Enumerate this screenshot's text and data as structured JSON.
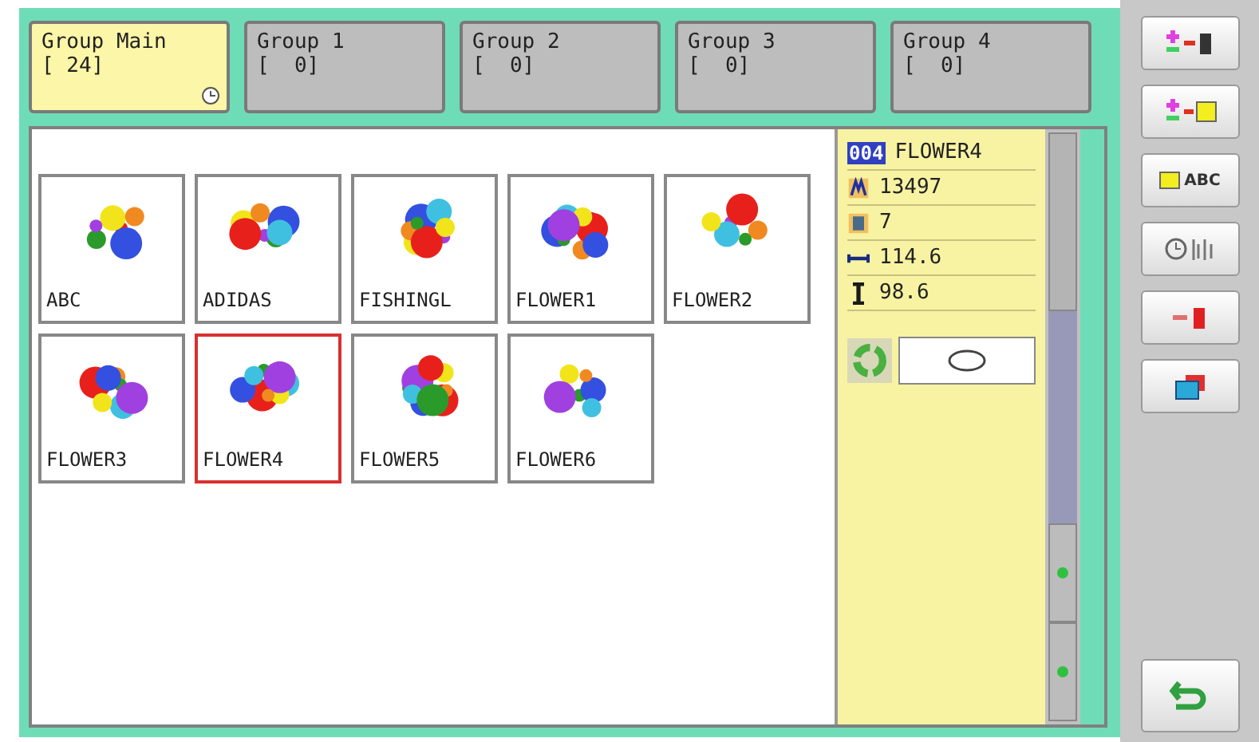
{
  "tabs": [
    {
      "label": "Group Main",
      "count": "[ 24]",
      "selected": true,
      "clock": true
    },
    {
      "label": "Group 1",
      "count": "[  0]",
      "selected": false,
      "clock": false
    },
    {
      "label": "Group 2",
      "count": "[  0]",
      "selected": false,
      "clock": false
    },
    {
      "label": "Group 3",
      "count": "[  0]",
      "selected": false,
      "clock": false
    },
    {
      "label": "Group 4",
      "count": "[  0]",
      "selected": false,
      "clock": false
    }
  ],
  "designs": [
    {
      "name": "ABC",
      "selected": false
    },
    {
      "name": "ADIDAS",
      "selected": false
    },
    {
      "name": "FISHINGL",
      "selected": false
    },
    {
      "name": "FLOWER1",
      "selected": false
    },
    {
      "name": "FLOWER2",
      "selected": false
    },
    {
      "name": "FLOWER3",
      "selected": false
    },
    {
      "name": "FLOWER4",
      "selected": true
    },
    {
      "name": "FLOWER5",
      "selected": false
    },
    {
      "name": "FLOWER6",
      "selected": false
    }
  ],
  "info": {
    "number": "004",
    "name": "FLOWER4",
    "rows": [
      {
        "kind": "stitches",
        "value": "13497"
      },
      {
        "kind": "colors",
        "value": "7"
      },
      {
        "kind": "width",
        "value": "114.6"
      },
      {
        "kind": "height",
        "value": "98.6"
      }
    ]
  },
  "sidebar": [
    {
      "kind": "delete-from-group"
    },
    {
      "kind": "move-to-folder"
    },
    {
      "kind": "folder-name",
      "label": "ABC"
    },
    {
      "kind": "sort"
    },
    {
      "kind": "add-to-machine"
    },
    {
      "kind": "copy"
    },
    {
      "kind": "return"
    }
  ]
}
